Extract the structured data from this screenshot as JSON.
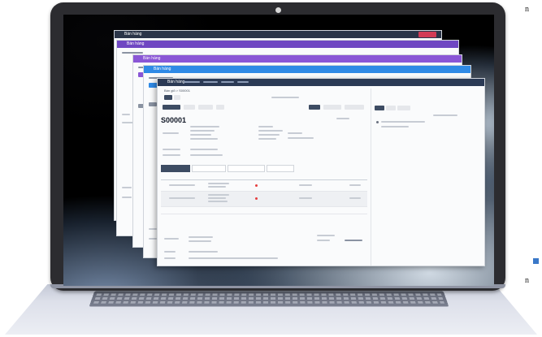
{
  "windows": [
    {
      "brand": "Bán hàng"
    },
    {
      "brand": "Bán hàng"
    },
    {
      "brand": "Bán hàng"
    },
    {
      "brand": "Bán hàng"
    },
    {
      "brand": "Bán hàng"
    }
  ],
  "document": {
    "breadcrumb": "Bán giỏ > S00001",
    "number": "S00001"
  },
  "side_text": [
    "n",
    "n"
  ],
  "colors": {
    "window_1_bar": "#2b3548",
    "window_2_bar": "#6f47c2",
    "window_3_bar": "#8a56d6",
    "window_4_bar": "#2f8ae6",
    "window_5_bar": "#2b3a55",
    "laptop_lid": "#2c2c30"
  }
}
